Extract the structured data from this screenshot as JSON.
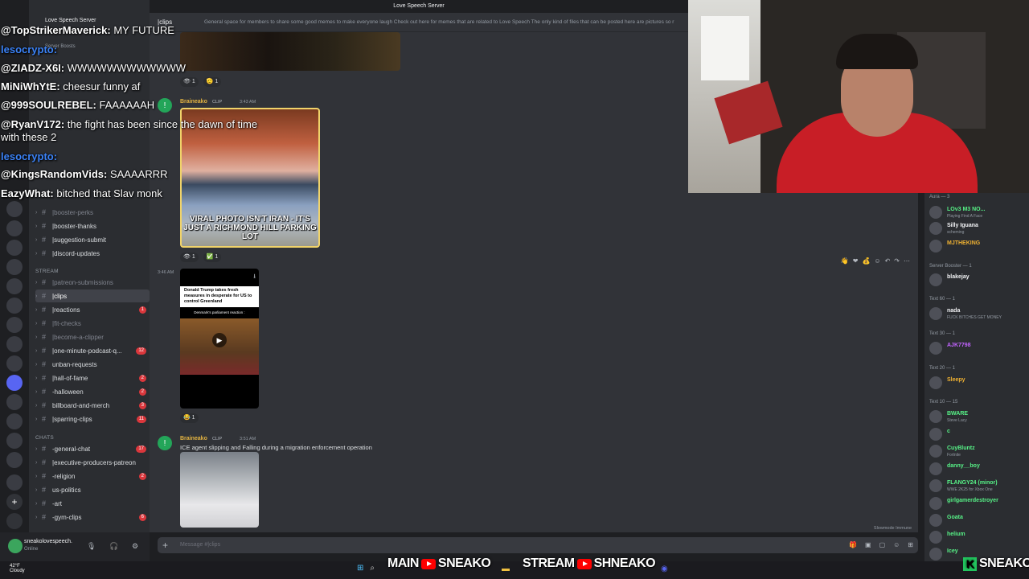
{
  "window": {
    "title": "Love Speech Server"
  },
  "server": {
    "name": "Love Speech Server",
    "boosts": "Server Boosts"
  },
  "channel_header": {
    "name": "|clips",
    "topic": "General space for members to share some good memes to make everyone laugh Check out here for memes that are related to Love Speech The only kind of files that can be posted here are pictures so r"
  },
  "categories": {
    "stream": "STREAM",
    "chats": "CHATS"
  },
  "channels_top": [
    {
      "label": "|booster-perks",
      "muted": true
    },
    {
      "label": "|booster-thanks",
      "muted": false
    },
    {
      "label": "|suggestion-submit",
      "muted": false
    },
    {
      "label": "|discord-updates",
      "muted": false
    }
  ],
  "channels_stream": [
    {
      "label": "|patreon-submissions",
      "muted": true,
      "count": ""
    },
    {
      "label": "|clips",
      "muted": false,
      "count": "",
      "active": true
    },
    {
      "label": "|reactions",
      "muted": false,
      "count": "1"
    },
    {
      "label": "|fit-checks",
      "muted": true,
      "count": ""
    },
    {
      "label": "|become-a-clipper",
      "muted": true,
      "count": ""
    },
    {
      "label": "|one-minute-podcast-q...",
      "muted": false,
      "count": "12"
    },
    {
      "label": "unban-requests",
      "muted": false,
      "count": ""
    },
    {
      "label": "|hall-of-fame",
      "muted": false,
      "count": "2"
    },
    {
      "label": "-halloween",
      "muted": false,
      "count": "2"
    },
    {
      "label": "billboard-and-merch",
      "muted": false,
      "count": "3"
    },
    {
      "label": "|sparring-clips",
      "muted": false,
      "count": "11"
    }
  ],
  "channels_chats": [
    {
      "label": "-general-chat",
      "count": "17"
    },
    {
      "label": "|executive-producers-patreon",
      "count": ""
    },
    {
      "label": "-religion",
      "count": "2"
    },
    {
      "label": "us-politics",
      "count": ""
    },
    {
      "label": "-art",
      "count": ""
    },
    {
      "label": "-gym-clips",
      "count": "6"
    }
  ],
  "user_panel": {
    "name": "sneakolovespeech.",
    "status": "Online"
  },
  "overlay_chat": [
    {
      "user": "@TopStrikerMaverick:",
      "msg": "MY FUTURE",
      "blue": false
    },
    {
      "user": "lesocrypto:",
      "msg": "",
      "blue": true
    },
    {
      "user": "@ZIADZ-X6I:",
      "msg": "WWWWWWWWWWWW",
      "blue": false
    },
    {
      "user": "MiNiWhYtE:",
      "msg": "cheesur funny af",
      "blue": false
    },
    {
      "user": "@999SOULREBEL:",
      "msg": "FAAAAAAH",
      "blue": false
    },
    {
      "user": "@RyanV172:",
      "msg": "the fight has been since the dawn of time",
      "blue": false
    },
    {
      "user": "",
      "msg": "with these 2",
      "blue": false
    },
    {
      "user": "lesocrypto:",
      "msg": "",
      "blue": true
    },
    {
      "user": "@KingsRandomVids:",
      "msg": "SAAAARRR",
      "blue": false
    },
    {
      "user": "EazyWhat:",
      "msg": "bitched that Slav monk",
      "blue": false
    }
  ],
  "messages": [
    {
      "author": "Braineako",
      "tag": "CLIP",
      "time": "3:43 AM",
      "caption": "VIRAL PHOTO ISN'T IRAN - IT'S JUST A RICHMOND HILL PARKING LOT",
      "reactions": [
        "1",
        "1"
      ]
    },
    {
      "time": "3:46 AM",
      "headline": "Donald Trump takes fresh measures in desperate for US to control Greenland",
      "sub": "Denmark's parliament reaction :",
      "reactions": [
        "1"
      ]
    },
    {
      "author": "Braineako",
      "tag": "CLIP",
      "time": "3:51 AM",
      "text": "ICE agent slipping and Falling during a migration enforcement operation"
    }
  ],
  "first_reactions": [
    "1",
    "1"
  ],
  "composer": {
    "placeholder": "Message #|clips"
  },
  "slowmode": "Slowmode Immune",
  "members": {
    "aura": "Aura — 3",
    "booster": "Server Booster — 1",
    "t60": "Text 60 — 1",
    "t30": "Text 30 — 1",
    "t20": "Text 20 — 1",
    "t10": "Text 10 — 15",
    "list": [
      {
        "name": "LOv3 M3 NO...",
        "sub": "Playing Find A Face",
        "color": "#57f287"
      },
      {
        "name": "Silly Iguana",
        "sub": "scheming",
        "color": "#f2f3f5"
      },
      {
        "name": "MJTHEKING",
        "sub": "",
        "color": "#f0b232"
      },
      {
        "name": "blakejay",
        "sub": "",
        "color": "#f2f3f5"
      },
      {
        "name": "nada",
        "sub": "FUCK BITCHES GET MONEY",
        "color": "#f2f3f5"
      },
      {
        "name": "AJK7798",
        "sub": "",
        "color": "#c264ff"
      },
      {
        "name": "Sleepy",
        "sub": "",
        "color": "#f0b232"
      },
      {
        "name": "BWARE",
        "sub": "Steve Lacy",
        "color": "#57f287"
      },
      {
        "name": "c",
        "sub": "",
        "color": "#57f287"
      },
      {
        "name": "CuyBluntz",
        "sub": "Fortnite",
        "color": "#57f287"
      },
      {
        "name": "danny__boy",
        "sub": "",
        "color": "#57f287"
      },
      {
        "name": "FLANGY24 (minor)",
        "sub": "WWE 2K25 for Xbox One",
        "color": "#57f287"
      },
      {
        "name": "girlgamerdestroyer",
        "sub": "",
        "color": "#57f287"
      },
      {
        "name": "Goata",
        "sub": "",
        "color": "#57f287"
      },
      {
        "name": "helium",
        "sub": "",
        "color": "#57f287"
      },
      {
        "name": "Icey",
        "sub": "",
        "color": "#57f287"
      }
    ]
  },
  "taskbar": {
    "temp": "42°F",
    "weather": "Cloudy"
  },
  "branding": {
    "main": "MAIN",
    "main_name": "SNEAKO",
    "stream": "STREAM",
    "stream_name": "SHNEAKO",
    "logo": "SNEAKO"
  }
}
